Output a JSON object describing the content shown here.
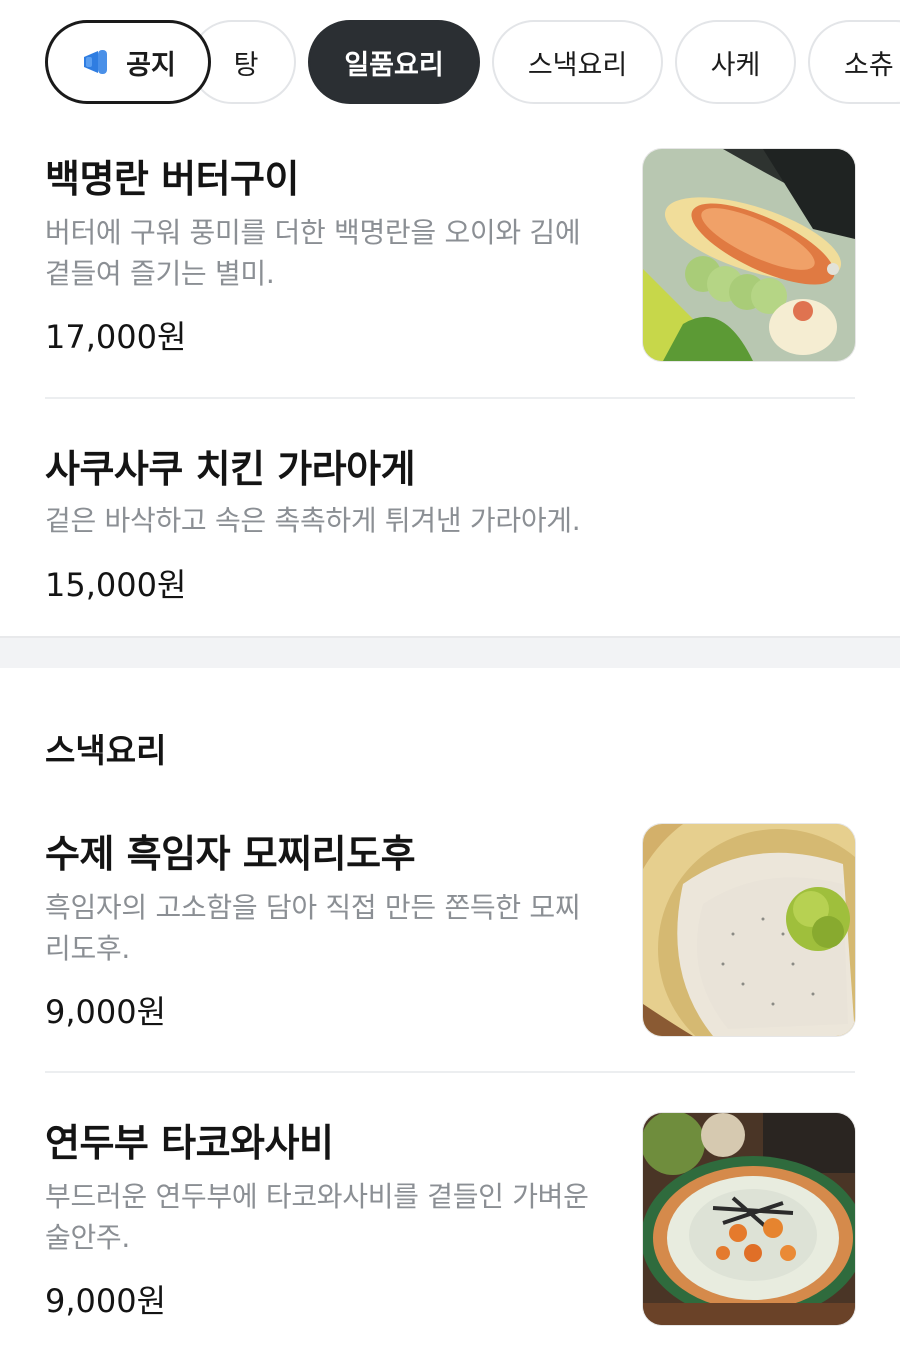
{
  "tabs": [
    {
      "label": "공지",
      "icon": "megaphone-icon"
    },
    {
      "label": "탕"
    },
    {
      "label": "일품요리",
      "active": true
    },
    {
      "label": "스낵요리"
    },
    {
      "label": "사케"
    },
    {
      "label": "소츄"
    }
  ],
  "sections": [
    {
      "title": "",
      "items": [
        {
          "name": "백명란 버터구이",
          "desc": "버터에 구워 풍미를 더한 백명란을 오이와 김에 곁들여 즐기는 별미.",
          "price": "17,000원",
          "image": "grilled-pollock-roe-photo"
        },
        {
          "name": "사쿠사쿠 치킨 가라아게",
          "desc": "겉은 바삭하고 속은 촉촉하게 튀겨낸 가라아게.",
          "price": "15,000원"
        }
      ]
    },
    {
      "title": "스낵요리",
      "items": [
        {
          "name": "수제 흑임자 모찌리도후",
          "desc": "흑임자의 고소함을 담아 직접 만든 쫀득한 모찌리도후.",
          "price": "9,000원",
          "image": "sesame-tofu-photo"
        },
        {
          "name": "연두부 타코와사비",
          "desc": "부드러운 연두부에 타코와사비를 곁들인 가벼운 술안주.",
          "price": "9,000원",
          "image": "tofu-takowasabi-photo"
        }
      ]
    }
  ],
  "colors": {
    "active_tab_bg": "#2b2f33",
    "desc_text": "#8b8f94",
    "megaphone": "#2f7de1"
  }
}
